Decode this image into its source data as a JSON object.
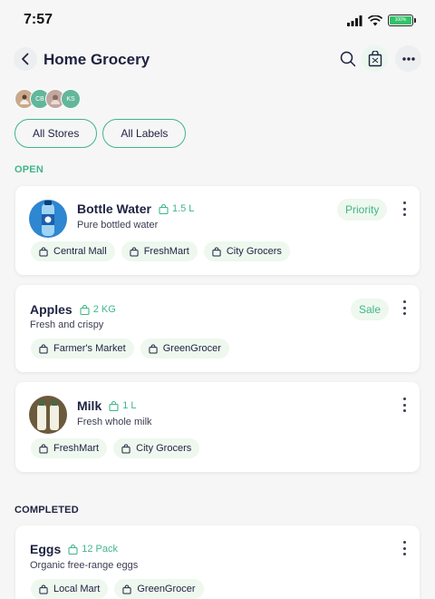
{
  "status": {
    "time": "7:57",
    "battery": "100%"
  },
  "header": {
    "title": "Home Grocery"
  },
  "avatars": [
    {
      "initials": "",
      "color": "#c9a98c"
    },
    {
      "initials": "CB",
      "color": "#62b79a"
    },
    {
      "initials": "",
      "color": "#c2a7a0"
    },
    {
      "initials": "KS",
      "color": "#62b79a"
    }
  ],
  "filters": {
    "stores": "All Stores",
    "labels": "All Labels"
  },
  "sections": {
    "open": "OPEN",
    "completed": "COMPLETED"
  },
  "colors": {
    "accent": "#42b68a",
    "tag_bg": "#eef8ee",
    "title": "#1e2240"
  },
  "items": [
    {
      "title": "Bottle Water",
      "quantity": "1.5 L",
      "description": "Pure bottled water",
      "badge": "Priority",
      "stores": [
        "Central Mall",
        "FreshMart",
        "City Grocers"
      ]
    },
    {
      "title": "Apples",
      "quantity": "2 KG",
      "description": "Fresh and crispy",
      "badge": "Sale",
      "stores": [
        "Farmer's Market",
        "GreenGrocer"
      ]
    },
    {
      "title": "Milk",
      "quantity": "1 L",
      "description": "Fresh whole milk",
      "stores": [
        "FreshMart",
        "City Grocers"
      ]
    }
  ],
  "completed_items": [
    {
      "title": "Eggs",
      "quantity": "12 Pack",
      "description": "Organic free-range eggs",
      "stores": [
        "Local Mart",
        "GreenGrocer"
      ]
    }
  ]
}
